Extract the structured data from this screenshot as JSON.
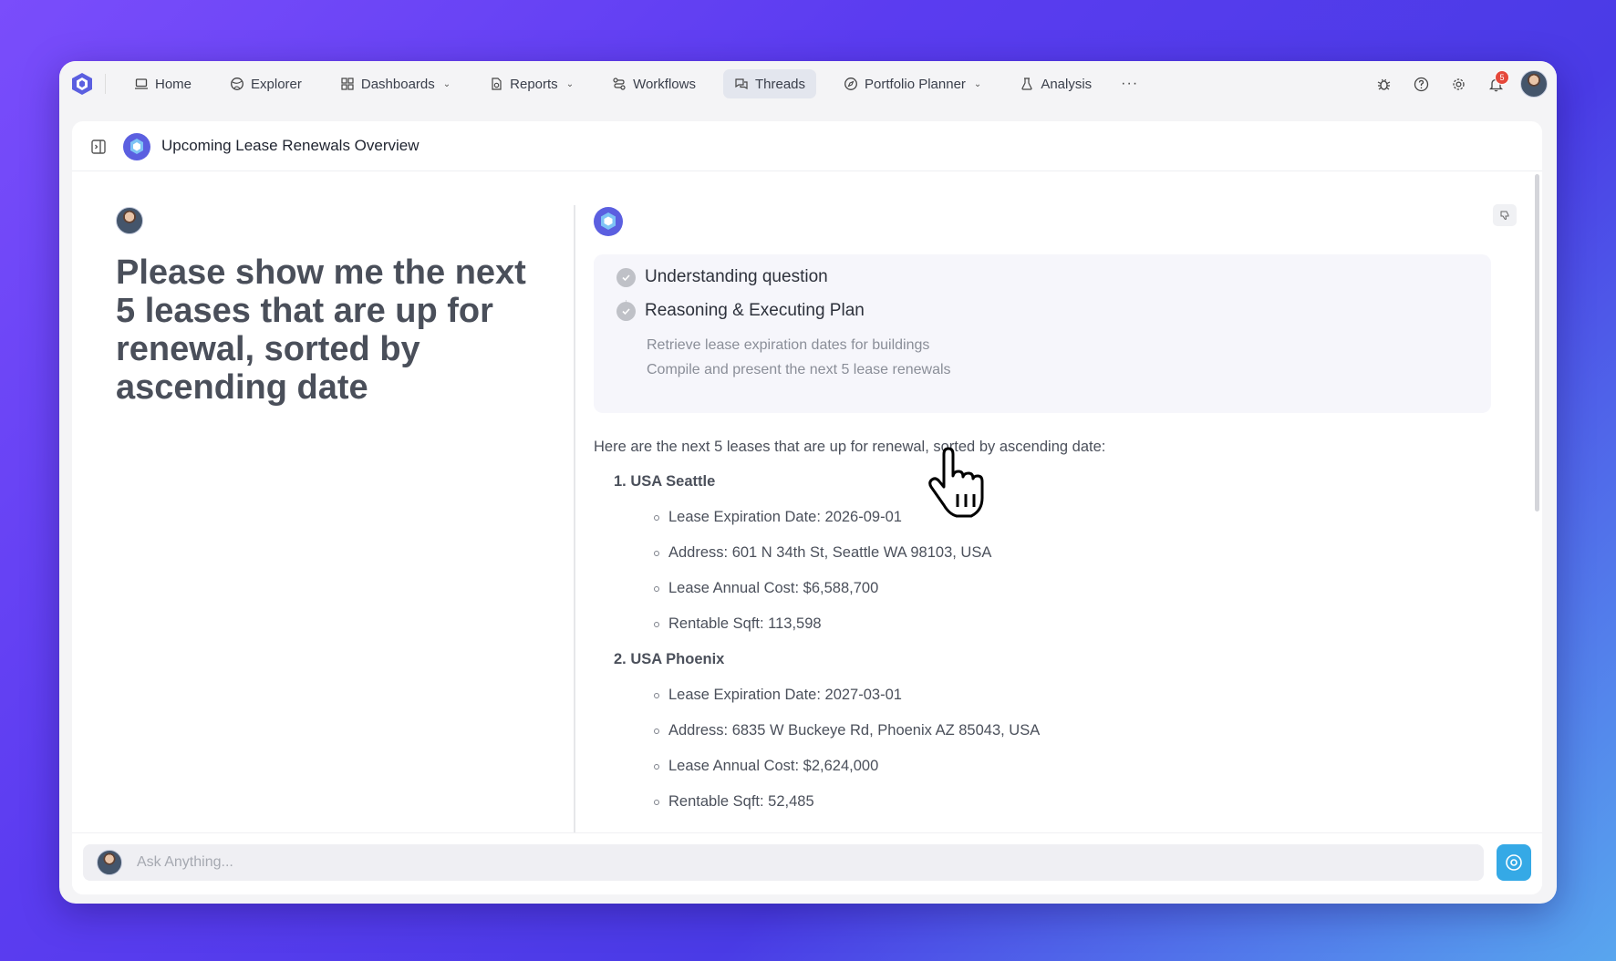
{
  "nav": {
    "items": [
      {
        "label": "Home",
        "icon": "laptop-icon"
      },
      {
        "label": "Explorer",
        "icon": "globe-icon"
      },
      {
        "label": "Dashboards",
        "icon": "grid-icon",
        "dropdown": true
      },
      {
        "label": "Reports",
        "icon": "report-icon",
        "dropdown": true
      },
      {
        "label": "Workflows",
        "icon": "workflow-icon"
      },
      {
        "label": "Threads",
        "icon": "chat-icon",
        "active": true
      },
      {
        "label": "Portfolio Planner",
        "icon": "compass-icon",
        "dropdown": true
      },
      {
        "label": "Analysis",
        "icon": "flask-icon"
      }
    ],
    "more": "···",
    "notification_count": "5"
  },
  "thread": {
    "title": "Upcoming Lease Renewals Overview"
  },
  "question": "Please show me the next 5 leases that are up for renewal, sorted by ascending date",
  "steps": [
    {
      "label": "Understanding question"
    },
    {
      "label": "Reasoning & Executing Plan"
    }
  ],
  "substeps": [
    "Retrieve lease expiration dates for buildings",
    "Compile and present the next 5 lease renewals"
  ],
  "answer": {
    "intro": "Here are the next 5 leases that are up for renewal, sorted by ascending date:",
    "items": [
      {
        "title": "1. USA Seattle",
        "details": [
          "Lease Expiration Date: 2026-09-01",
          "Address: 601 N 34th St, Seattle WA 98103, USA",
          "Lease Annual Cost: $6,588,700",
          "Rentable Sqft: 113,598"
        ]
      },
      {
        "title": "2. USA Phoenix",
        "details": [
          "Lease Expiration Date: 2027-03-01",
          "Address: 6835 W Buckeye Rd, Phoenix AZ 85043, USA",
          "Lease Annual Cost: $2,624,000",
          "Rentable Sqft: 52,485"
        ]
      }
    ]
  },
  "input": {
    "placeholder": "Ask Anything..."
  },
  "colors": {
    "accent": "#35a9e6",
    "brand": "#5b5fe0",
    "badge": "#e5483b"
  }
}
